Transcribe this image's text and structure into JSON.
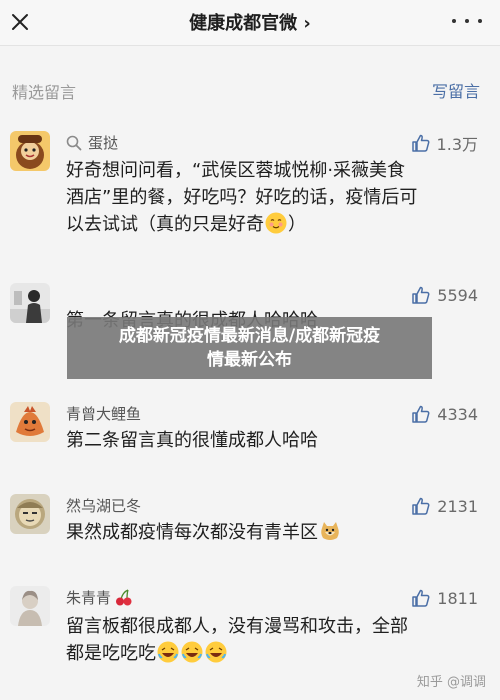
{
  "header": {
    "title": "健康成都官微 ›"
  },
  "section": {
    "title": "精选留言",
    "write_label": "写留言"
  },
  "comments": [
    {
      "name": "蛋挞",
      "likes": "1.3万",
      "lines": [
        "好奇想问问看，“武侯区蓉城悦柳·采薇美食",
        "酒店”里的餐，好吃吗？好吃的话，疫情后可",
        "以去试试（真的只是好奇"
      ],
      "line_tail": "）",
      "emoji": "blush"
    },
    {
      "name": "",
      "likes": "5594",
      "lines": [
        "第一条留言真的很成都人哈哈哈"
      ]
    },
    {
      "name": "青曾大鲤鱼",
      "likes": "4334",
      "lines": [
        "第二条留言真的很懂成都人哈哈"
      ]
    },
    {
      "name": "然乌湖已冬",
      "likes": "2131",
      "lines": [
        "果然成都疫情每次都没有青羊区"
      ],
      "emoji": "doge"
    },
    {
      "name": "朱青青",
      "likes": "1811",
      "lines": [
        "留言板都很成都人，没有漫骂和攻击，全部",
        "都是吃吃吃"
      ],
      "emoji": "laugh"
    }
  ],
  "overlay": {
    "line1": "成都新冠疫情最新消息/成都新冠疫",
    "line2": "情最新公布"
  },
  "watermark": "知乎 @调调",
  "colors": {
    "link": "#4b6fa6",
    "muted": "#9a9a9a",
    "overlay": "#787878"
  },
  "icons": [
    "close-icon",
    "more-icon",
    "search-icon",
    "thumb-up-icon",
    "cherry-icon"
  ]
}
